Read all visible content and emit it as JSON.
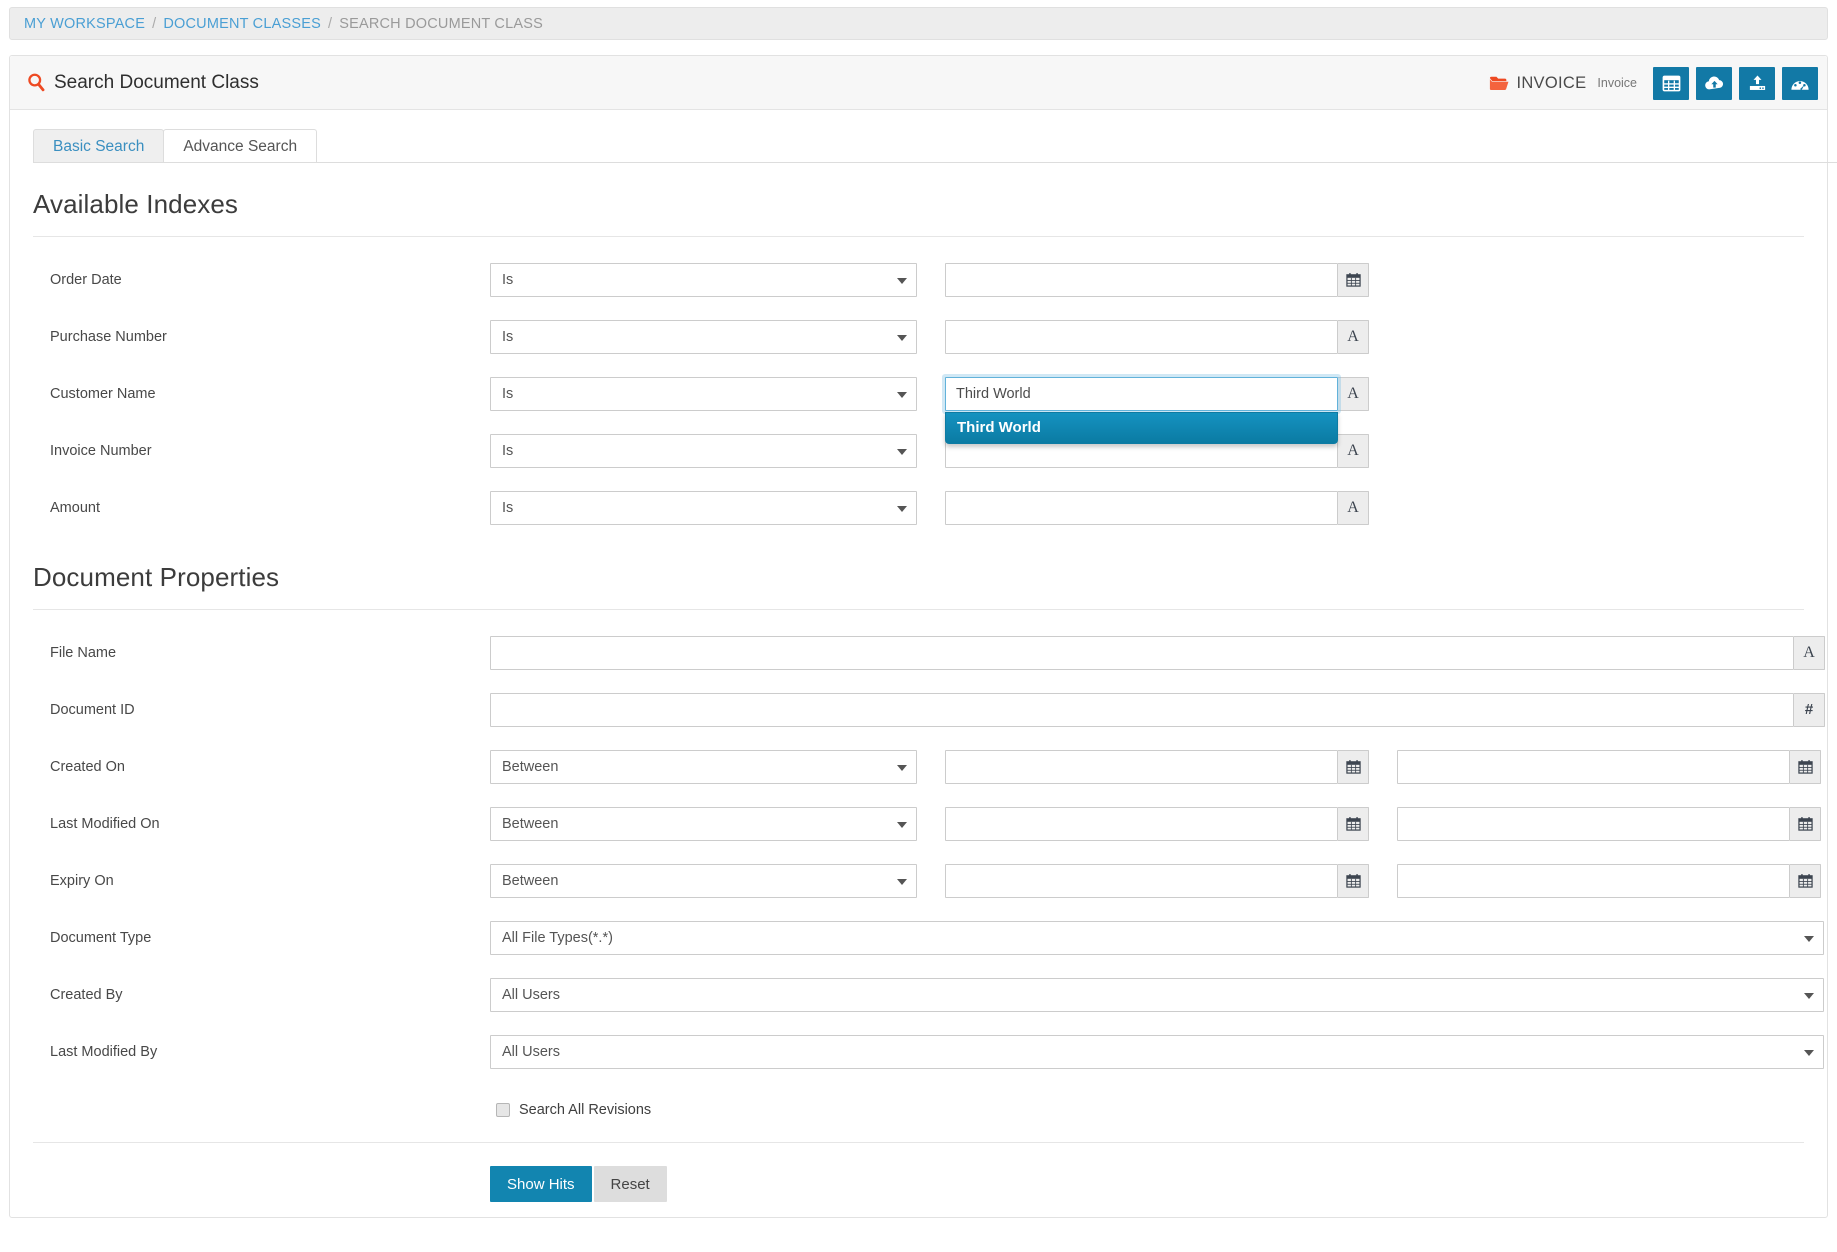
{
  "breadcrumb": {
    "items": [
      {
        "label": "MY WORKSPACE",
        "type": "link"
      },
      {
        "label": "DOCUMENT CLASSES",
        "type": "link"
      },
      {
        "label": "SEARCH DOCUMENT CLASS",
        "type": "current"
      }
    ],
    "separator": "/"
  },
  "header": {
    "title": "Search Document Class",
    "search_icon": "search-icon",
    "folder": {
      "icon": "folder-icon",
      "name": "INVOICE",
      "subtitle": "Invoice"
    },
    "actions": [
      {
        "name": "grid-view-icon",
        "title": "Grid View"
      },
      {
        "name": "cloud-upload-icon",
        "title": "Cloud Upload"
      },
      {
        "name": "upload-icon",
        "title": "Upload"
      },
      {
        "name": "dashboard-icon",
        "title": "Dashboard"
      }
    ]
  },
  "tabs": [
    {
      "label": "Basic Search",
      "active": true
    },
    {
      "label": "Advance Search",
      "active": false
    }
  ],
  "available_indexes": {
    "heading": "Available Indexes",
    "rows": [
      {
        "label": "Order Date",
        "operator": "Is",
        "value": "",
        "placeholder": "",
        "addon": "calendar-icon"
      },
      {
        "label": "Purchase Number",
        "operator": "Is",
        "value": "",
        "placeholder": "",
        "addon": "A"
      },
      {
        "label": "Customer Name",
        "operator": "Is",
        "value": "Third World",
        "placeholder": "",
        "addon": "A",
        "focused": true,
        "suggestions": [
          "Third World"
        ]
      },
      {
        "label": "Invoice Number",
        "operator": "Is",
        "value": "",
        "placeholder": "",
        "addon": "A"
      },
      {
        "label": "Amount",
        "operator": "Is",
        "value": "",
        "placeholder": "",
        "addon": "A"
      }
    ]
  },
  "document_properties": {
    "heading": "Document Properties",
    "file_name": {
      "label": "File Name",
      "value": "",
      "addon": "A"
    },
    "document_id": {
      "label": "Document ID",
      "value": "",
      "addon": "#"
    },
    "created_on": {
      "label": "Created On",
      "operator": "Between",
      "from": "",
      "to": "",
      "addon": "calendar-icon"
    },
    "last_modified_on": {
      "label": "Last Modified On",
      "operator": "Between",
      "from": "",
      "to": "",
      "addon": "calendar-icon"
    },
    "expiry_on": {
      "label": "Expiry On",
      "operator": "Between",
      "from": "",
      "to": "",
      "addon": "calendar-icon"
    },
    "document_type": {
      "label": "Document Type",
      "value": "All File Types(*.*)"
    },
    "created_by": {
      "label": "Created By",
      "value": "All Users"
    },
    "last_modified_by": {
      "label": "Last Modified By",
      "value": "All Users"
    },
    "search_all_revisions": {
      "label": "Search All Revisions",
      "checked": false
    }
  },
  "footer": {
    "show_hits_label": "Show Hits",
    "reset_label": "Reset"
  },
  "colors": {
    "accent_blue": "#1285b0",
    "link_blue": "#4a9fd4",
    "brand_orange": "#ee4a23",
    "highlight": "#0b7ba3"
  }
}
